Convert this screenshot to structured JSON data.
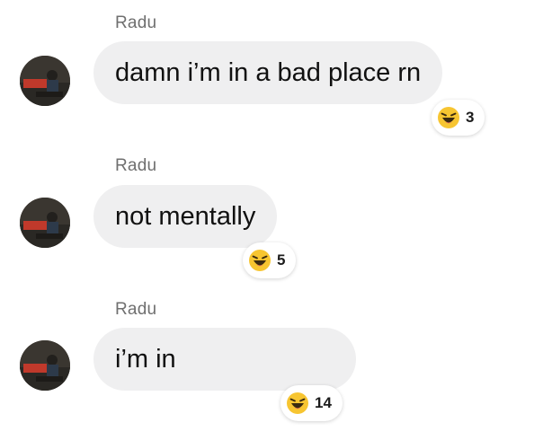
{
  "messages": [
    {
      "sender": "Radu",
      "text": "damn i’m in a bad place rn",
      "reaction": {
        "icon": "laughing-emoji-icon",
        "count": "3"
      }
    },
    {
      "sender": "Radu",
      "text": "not mentally",
      "reaction": {
        "icon": "laughing-emoji-icon",
        "count": "5"
      }
    },
    {
      "sender": "Radu",
      "text": "i’m in",
      "reaction": {
        "icon": "laughing-emoji-icon",
        "count": "14"
      }
    }
  ],
  "colors": {
    "bubble": "#efeff0",
    "sender_text": "#6f6f6f",
    "emoji_face": "#f7c531"
  }
}
